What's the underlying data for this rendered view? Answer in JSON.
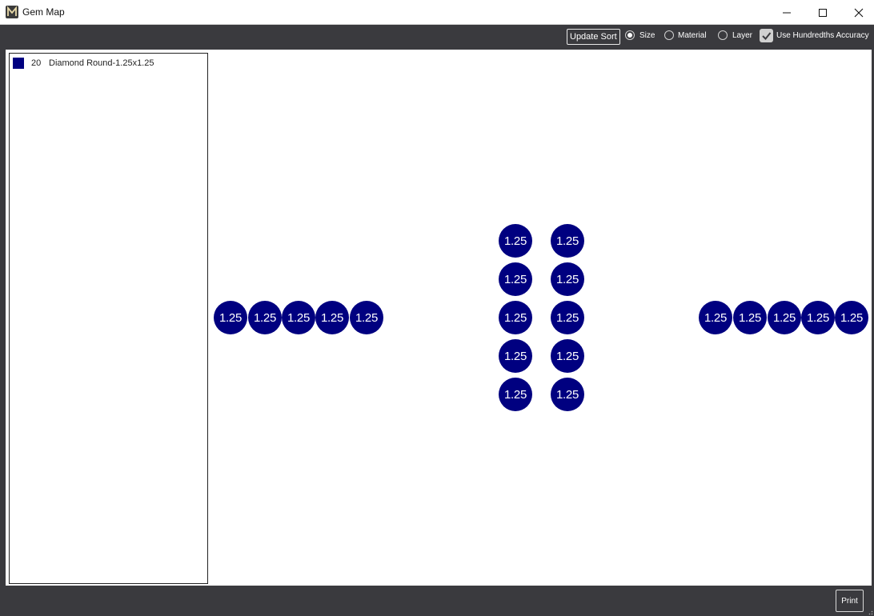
{
  "window": {
    "title": "Gem Map",
    "app_icon": "m-logo-icon",
    "controls": [
      "minimize-icon",
      "maximize-icon",
      "close-icon"
    ]
  },
  "toolbar": {
    "update_sort_label": "Update Sort",
    "sort_options": [
      {
        "label": "Size",
        "selected": true
      },
      {
        "label": "Material",
        "selected": false
      },
      {
        "label": "Layer",
        "selected": false
      }
    ],
    "hundredths_label": "Use Hundredths Accuracy",
    "hundredths_checked": true
  },
  "legend": {
    "items": [
      {
        "count": "20",
        "name": "Diamond Round-1.25x1.25",
        "color": "#000080"
      }
    ]
  },
  "gem_map": {
    "gem_label": "1.25",
    "gem_color": "#000080",
    "gem_count": 20
  },
  "footer": {
    "print_label": "Print"
  }
}
